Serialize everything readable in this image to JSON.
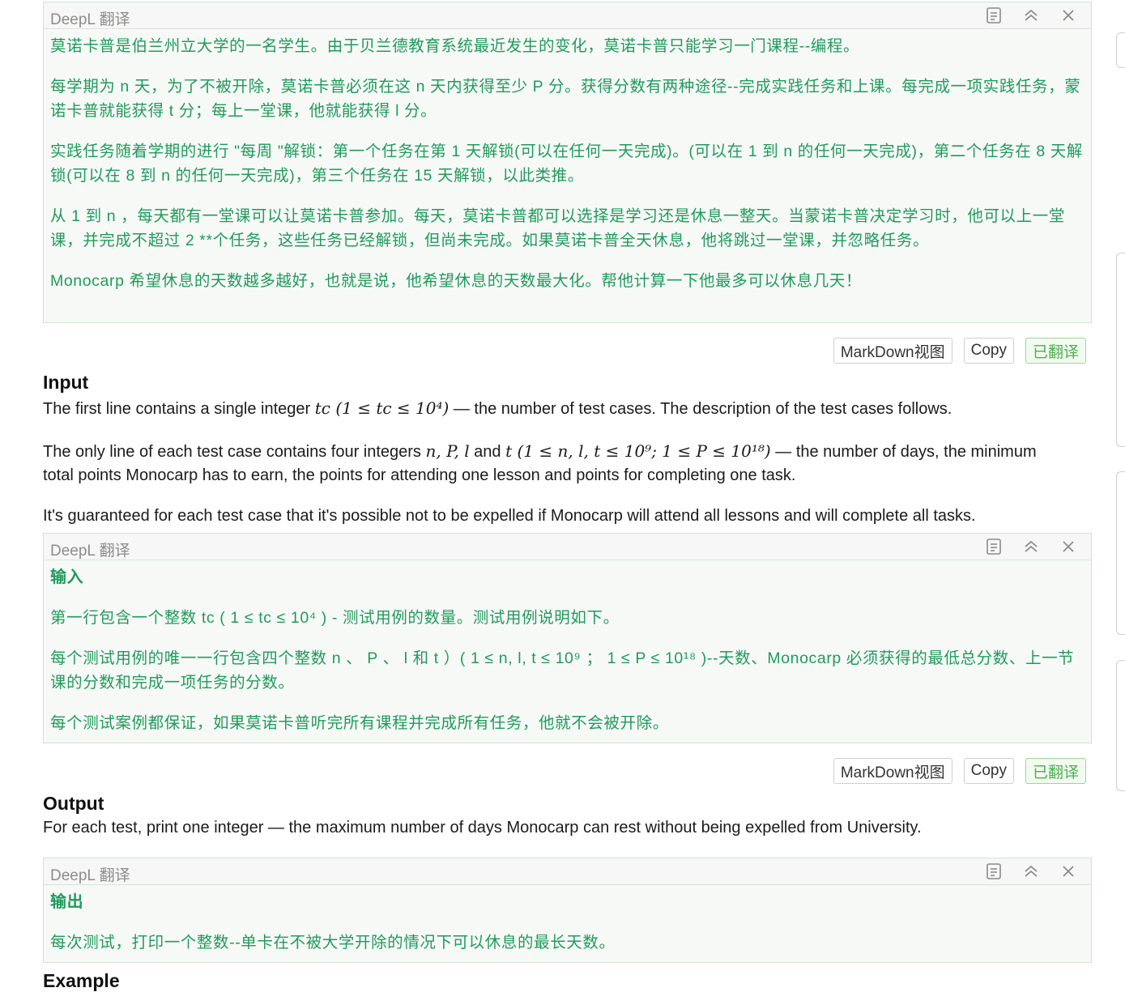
{
  "deepl_title": "DeepL 翻译",
  "box1": {
    "p1": "莫诺卡普是伯兰州立大学的一名学生。由于贝兰德教育系统最近发生的变化，莫诺卡普只能学习一门课程--编程。",
    "p2": "每学期为 n 天，为了不被开除，莫诺卡普必须在这 n 天内获得至少 P 分。获得分数有两种途径--完成实践任务和上课。每完成一项实践任务，蒙诺卡普就能获得 t 分；每上一堂课，他就能获得 l 分。",
    "p3": "实践任务随着学期的进行 \"每周 \"解锁：第一个任务在第 1 天解锁(可以在任何一天完成)。(可以在 1 到 n 的任何一天完成)，第二个任务在 8 天解锁(可以在 8 到 n 的任何一天完成)，第三个任务在 15 天解锁，以此类推。",
    "p4": "从 1 到 n ，每天都有一堂课可以让莫诺卡普参加。每天，莫诺卡普都可以选择是学习还是休息一整天。当蒙诺卡普决定学习时，他可以上一堂课，并完成不超过 2 **个任务，这些任务已经解锁，但尚未完成。如果莫诺卡普全天休息，他将跳过一堂课，并忽略任务。",
    "p5": "Monocarp 希望休息的天数越多越好，也就是说，他希望休息的天数最大化。帮他计算一下他最多可以休息几天！"
  },
  "buttons": {
    "markdown": "MarkDown视图",
    "copy": "Copy",
    "translated": "已翻译"
  },
  "input": {
    "heading": "Input",
    "l1_a": "The first line contains a single integer ",
    "l1_math": "tc (1 ≤ tc ≤ 10⁴)",
    "l1_b": " — the number of test cases. The description of the test cases follows.",
    "l2_a": "The only line of each test case contains four integers ",
    "l2_math1": "n, P, l",
    "l2_and": " and ",
    "l2_math2": "t (1 ≤ n, l, t ≤ 10⁹; 1 ≤ P ≤ 10¹⁸)",
    "l2_b": " — the number of days, the minimum total points Monocarp has to earn, the points for attending one lesson and points for completing one task.",
    "l3": "It's guaranteed for each test case that it's possible not to be expelled if Monocarp will attend all lessons and will complete all tasks."
  },
  "box2": {
    "heading": "输入",
    "p1": "第一行包含一个整数 tc ( 1 ≤ tc ≤ 10⁴ ) - 测试用例的数量。测试用例说明如下。",
    "p2": "每个测试用例的唯一一行包含四个整数 n 、 P 、 l 和 t ）( 1 ≤ n, l, t ≤ 10⁹ ； 1 ≤ P ≤ 10¹⁸ )--天数、Monocarp 必须获得的最低总分数、上一节课的分数和完成一项任务的分数。",
    "p3": "每个测试案例都保证，如果莫诺卡普听完所有课程并完成所有任务，他就不会被开除。"
  },
  "output": {
    "heading": "Output",
    "l1": "For each test, print one integer — the maximum number of days Monocarp can rest without being expelled from University."
  },
  "box3": {
    "heading": "输出",
    "p1": "每次测试，打印一个整数--单卡在不被大学开除的情况下可以休息的最长天数。"
  },
  "next_heading": "Example"
}
